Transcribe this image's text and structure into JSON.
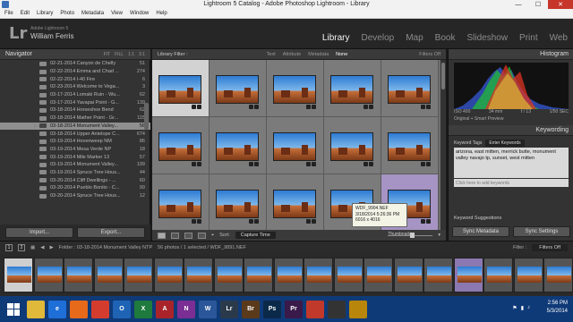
{
  "window": {
    "title": "Lightroom 5 Catalog - Adobe Photoshop Lightroom - Library"
  },
  "menu": [
    "File",
    "Edit",
    "Library",
    "Photo",
    "Metadata",
    "View",
    "Window",
    "Help"
  ],
  "identity": {
    "logo": "Lr",
    "version": "Adobe Lightroom 5",
    "user": "William Ferris"
  },
  "modules": [
    "Library",
    "Develop",
    "Map",
    "Book",
    "Slideshow",
    "Print",
    "Web"
  ],
  "left_panel": {
    "navigator": "Navigator",
    "fit_options": [
      "FIT",
      "FILL",
      "1:1",
      "3:1"
    ],
    "folders": [
      {
        "name": "02-21-2014 Canyon de Chelly",
        "count": "51"
      },
      {
        "name": "02-22-2014 Emma and Chad ...",
        "count": "274"
      },
      {
        "name": "02-22-2014 I-40 Fire",
        "count": "6"
      },
      {
        "name": "02-23-2014 Welcome to Vega...",
        "count": "3"
      },
      {
        "name": "03-17-2014 Lomaki Ruin - Wu...",
        "count": "62"
      },
      {
        "name": "03-17-2014 Yavapai Point - G...",
        "count": "139"
      },
      {
        "name": "03-18-2014 Horseshoe Bend",
        "count": "62"
      },
      {
        "name": "03-18-2014 Mather Point - Gr...",
        "count": "115"
      },
      {
        "name": "03-18-2014 Monument Valley...",
        "count": "56",
        "selected": true
      },
      {
        "name": "03-18-2014 Upper Antelope C...",
        "count": "674"
      },
      {
        "name": "03-19-2014 Hovenweep NM",
        "count": "86"
      },
      {
        "name": "03-19-2014 Mesa Verde NP",
        "count": "18"
      },
      {
        "name": "03-19-2014 Mile Marker 13",
        "count": "57"
      },
      {
        "name": "03-19-2014 Monument Valley...",
        "count": "199"
      },
      {
        "name": "03-19-2014 Spruce Tree Hous...",
        "count": "44"
      },
      {
        "name": "03-20-2014 Cliff Dwellings - ...",
        "count": "60"
      },
      {
        "name": "03-20-2014 Pueblo Bonito - C...",
        "count": "99"
      },
      {
        "name": "03-20-2014 Spruce Tree Hous...",
        "count": "12"
      }
    ],
    "import_label": "Import...",
    "export_label": "Export..."
  },
  "filter_bar": {
    "label": "Library Filter :",
    "options": [
      "Text",
      "Attribute",
      "Metadata",
      "None"
    ],
    "filters_off": "Filters Off"
  },
  "grid": {
    "selected_index": 0,
    "purple_index": 14
  },
  "tooltip": {
    "file": "WDF_9904.NEF",
    "date": "3/18/2014 5:26:36 PM",
    "size": "6016 x 4016"
  },
  "toolbar": {
    "sort_label": "Sort:",
    "sort_value": "Capture Time",
    "thumbnails_label": "Thumbnails",
    "thumbnail_size": 0.55
  },
  "right_panel": {
    "histogram": "Histogram",
    "histo_info": [
      "ISO 400",
      "34 mm",
      "f / 13",
      "1/50 SEC"
    ],
    "smart_preview": "Original + Smart Preview",
    "keywording": "Keywording",
    "keyword_tags_label": "Keyword Tags",
    "keyword_tags_select": "Enter Keywords",
    "keywords_text": "arizona, east mitten, merrick butte, monument valley navajo tp, sunset, west mitten",
    "keyword_placeholder": "Click here to add keywords",
    "keyword_suggestions": "Keyword Suggestions",
    "sync_metadata": "Sync Metadata",
    "sync_settings": "Sync Settings"
  },
  "filmstrip": {
    "page_buttons": [
      "1",
      "2"
    ],
    "folder_path": "Folder : 03-18-2014 Monument Valley NTP",
    "count_info": "56 photos / 1 selected / WDF_9891.NEF",
    "filter_label": "Filter :",
    "filter_value": "Filters Off"
  },
  "taskbar": {
    "apps": [
      {
        "name": "file-explorer",
        "label": "",
        "color": "#e0b83a"
      },
      {
        "name": "ie",
        "label": "e",
        "color": "#1e6fd8"
      },
      {
        "name": "firefox",
        "label": "",
        "color": "#e66a1a"
      },
      {
        "name": "chrome",
        "label": "",
        "color": "#d43d2e"
      },
      {
        "name": "outlook",
        "label": "O",
        "color": "#1f63b5"
      },
      {
        "name": "excel",
        "label": "X",
        "color": "#1f7a3d"
      },
      {
        "name": "access",
        "label": "A",
        "color": "#a8242a"
      },
      {
        "name": "onenote",
        "label": "N",
        "color": "#7b2e94"
      },
      {
        "name": "word",
        "label": "W",
        "color": "#2b579a"
      },
      {
        "name": "lightroom",
        "label": "Lr",
        "color": "#2b3a4a"
      },
      {
        "name": "bridge",
        "label": "Br",
        "color": "#5a3a1a"
      },
      {
        "name": "photoshop",
        "label": "Ps",
        "color": "#0b2a4a"
      },
      {
        "name": "premiere",
        "label": "Pr",
        "color": "#3a1a4a"
      },
      {
        "name": "app-red",
        "label": "",
        "color": "#c0392b"
      },
      {
        "name": "app-dark",
        "label": "",
        "color": "#333"
      },
      {
        "name": "app-gold",
        "label": "",
        "color": "#b8860b"
      }
    ],
    "time": "2:56 PM",
    "date": "5/3/2014"
  }
}
